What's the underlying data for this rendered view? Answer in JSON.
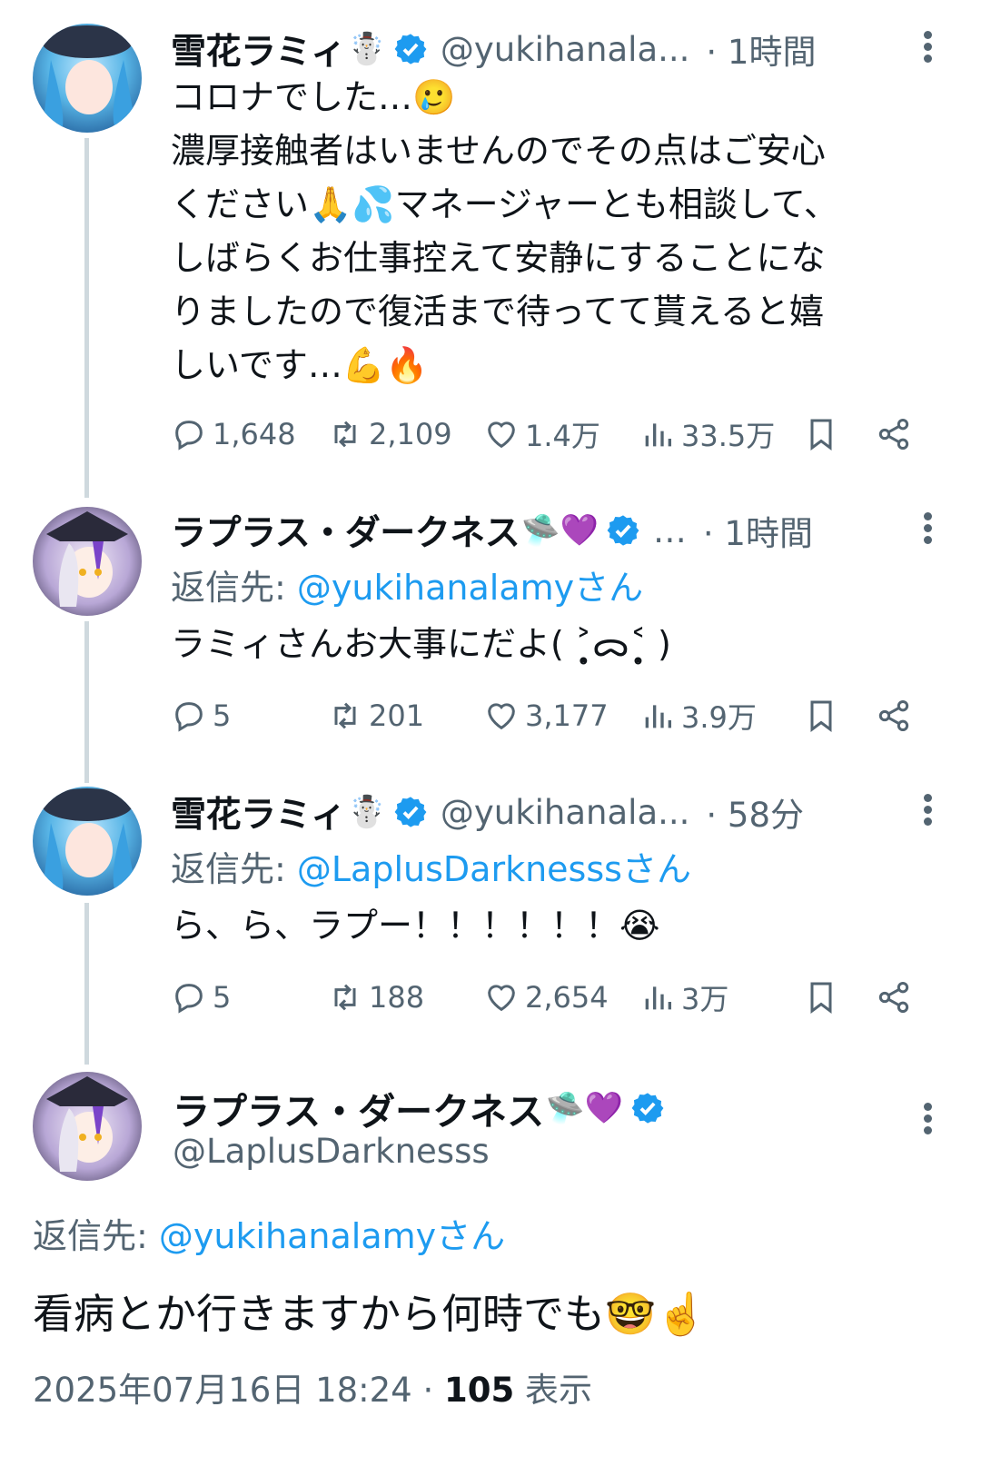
{
  "colors": {
    "link": "#1d9bf0",
    "muted": "#536471",
    "verified": "#1d9bf0",
    "thread_line": "#cfd9de"
  },
  "tweets": [
    {
      "name": "雪花ラミィ",
      "name_emoji": "☃️",
      "handle": "@yukihanala...",
      "time": "· 1時間",
      "lines": [
        "コロナでした…🥲",
        "濃厚接触者はいませんのでその点はご安心",
        "ください🙏💦マネージャーとも相談して、",
        "しばらくお仕事控えて安静にすることにな",
        "りましたので復活まで待ってて貰えると嬉",
        "しいです…💪🔥"
      ],
      "replies": "1,648",
      "reposts": "2,109",
      "likes": "1.4万",
      "views": "33.5万"
    },
    {
      "name": "ラプラス・ダークネス",
      "name_emoji": "🛸💜",
      "handle": "…",
      "time": "· 1時間",
      "reply_label": "返信先: ",
      "reply_to": "@yukihanalamyさん",
      "text": "ラミィさんお大事にだよ( ˃̣̣̥ᯅ˂̣̣̥ )",
      "replies": "5",
      "reposts": "201",
      "likes": "3,177",
      "views": "3.9万"
    },
    {
      "name": "雪花ラミィ",
      "name_emoji": "☃️",
      "handle": "@yukihanala...",
      "time": "· 58分",
      "reply_label": "返信先: ",
      "reply_to": "@LaplusDarknesssさん",
      "text": "ら、ら、ラプー！！！！！！😭",
      "replies": "5",
      "reposts": "188",
      "likes": "2,654",
      "views": "3万"
    }
  ],
  "main_tweet": {
    "name": "ラプラス・ダークネス",
    "name_emoji": "🛸💜",
    "handle": "@LaplusDarknesss",
    "reply_label": "返信先: ",
    "reply_to": "@yukihanalamyさん",
    "text": "看病とか行きますから何時でも🤓☝️",
    "timestamp": "2025年07月16日 18:24 · ",
    "view_count": "105",
    "view_label": " 表示"
  }
}
